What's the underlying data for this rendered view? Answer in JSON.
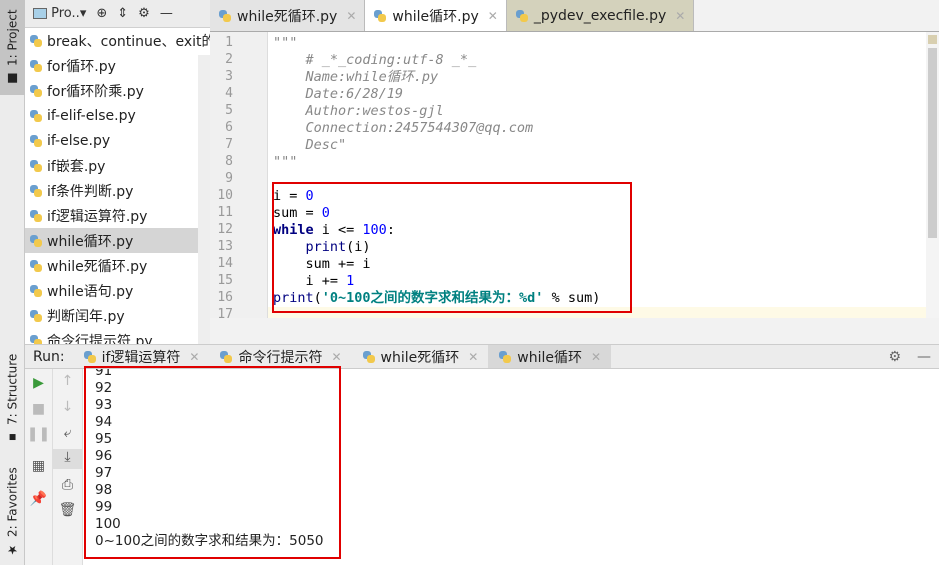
{
  "left_strip": {
    "project": "1: Project",
    "structure": "7: Structure",
    "favorites": "2: Favorites"
  },
  "project_panel": {
    "title": "Pro..",
    "files": [
      "break、continue、exit的",
      "for循环.py",
      "for循环阶乘.py",
      "if-elif-else.py",
      "if-else.py",
      "if嵌套.py",
      "if条件判断.py",
      "if逻辑运算符.py",
      "while循环.py",
      "while死循环.py",
      "while语句.py",
      "判断闰年.py",
      "命令行提示符.py"
    ],
    "selected": "while循环.py"
  },
  "editor_tabs": [
    {
      "label": "while死循环.py"
    },
    {
      "label": "while循环.py"
    },
    {
      "label": "_pydev_execfile.py"
    }
  ],
  "code": [
    [
      {
        "t": "\"\"\"",
        "c": "#888"
      }
    ],
    [
      {
        "t": "    # _*_coding:utf-8 _*_",
        "c": "#888",
        "i": 1
      }
    ],
    [
      {
        "t": "    Name:while循环.py",
        "c": "#888",
        "i": 1
      }
    ],
    [
      {
        "t": "    Date:6/28/19",
        "c": "#888",
        "i": 1
      }
    ],
    [
      {
        "t": "    Author:westos-gjl",
        "c": "#888",
        "i": 1
      }
    ],
    [
      {
        "t": "    Connection:2457544307@qq.com",
        "c": "#888",
        "i": 1
      }
    ],
    [
      {
        "t": "    Desc\"",
        "c": "#888",
        "i": 1
      }
    ],
    [
      {
        "t": "\"\"\"",
        "c": "#888"
      }
    ],
    [],
    [
      {
        "t": "i = ",
        "c": "#000"
      },
      {
        "t": "0",
        "c": "#0000ff"
      }
    ],
    [
      {
        "t": "sum = ",
        "c": "#000"
      },
      {
        "t": "0",
        "c": "#0000ff"
      }
    ],
    [
      {
        "t": "while",
        "c": "#000080",
        "b": 1
      },
      {
        "t": " i <= ",
        "c": "#000"
      },
      {
        "t": "100",
        "c": "#0000ff"
      },
      {
        "t": ":",
        "c": "#000"
      }
    ],
    [
      {
        "t": "    ",
        "c": "#000"
      },
      {
        "t": "print",
        "c": "#000080"
      },
      {
        "t": "(i)",
        "c": "#000"
      }
    ],
    [
      {
        "t": "    sum += i",
        "c": "#000"
      }
    ],
    [
      {
        "t": "    i += ",
        "c": "#000"
      },
      {
        "t": "1",
        "c": "#0000ff"
      }
    ],
    [
      {
        "t": "print",
        "c": "#000080"
      },
      {
        "t": "(",
        "c": "#000"
      },
      {
        "t": "'0~100之间的数字求和结果为：%d'",
        "c": "#008080",
        "b": 1
      },
      {
        "t": " % sum)",
        "c": "#000"
      }
    ],
    []
  ],
  "run": {
    "label": "Run:",
    "tabs": [
      "if逻辑运算符",
      "命令行提示符",
      "while死循环",
      "while循环"
    ],
    "active": "while循环",
    "output": [
      "91",
      "92",
      "93",
      "94",
      "95",
      "96",
      "97",
      "98",
      "99",
      "100",
      "0~100之间的数字求和结果为：5050"
    ]
  }
}
